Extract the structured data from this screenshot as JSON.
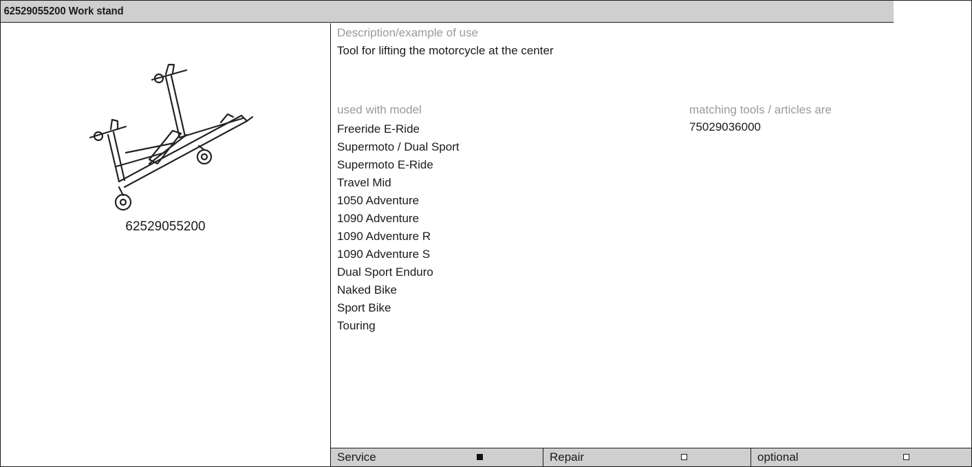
{
  "header": {
    "title": "62529055200 Work stand"
  },
  "tool": {
    "image_icon": "work-stand-illustration",
    "part_number": "62529055200"
  },
  "description": {
    "label": "Description/example of use",
    "text": "Tool for lifting the motorcycle at the center"
  },
  "models": {
    "label": "used with model",
    "items": [
      "Freeride E-Ride",
      "Supermoto / Dual Sport",
      "Supermoto E-Ride",
      "Travel Mid",
      "1050 Adventure",
      "1090 Adventure",
      "1090 Adventure R",
      "1090 Adventure S",
      "Dual Sport Enduro",
      "Naked Bike",
      "Sport Bike",
      "Touring"
    ]
  },
  "matching": {
    "label": "matching tools / articles are",
    "items": [
      "75029036000"
    ]
  },
  "categories": [
    {
      "label": "Service",
      "checked": true
    },
    {
      "label": "Repair",
      "checked": false
    },
    {
      "label": "optional",
      "checked": false
    }
  ],
  "colors": {
    "header_bg": "#cfcfcf",
    "label_gray": "#9a9a9a",
    "border": "#1a1a1a"
  }
}
